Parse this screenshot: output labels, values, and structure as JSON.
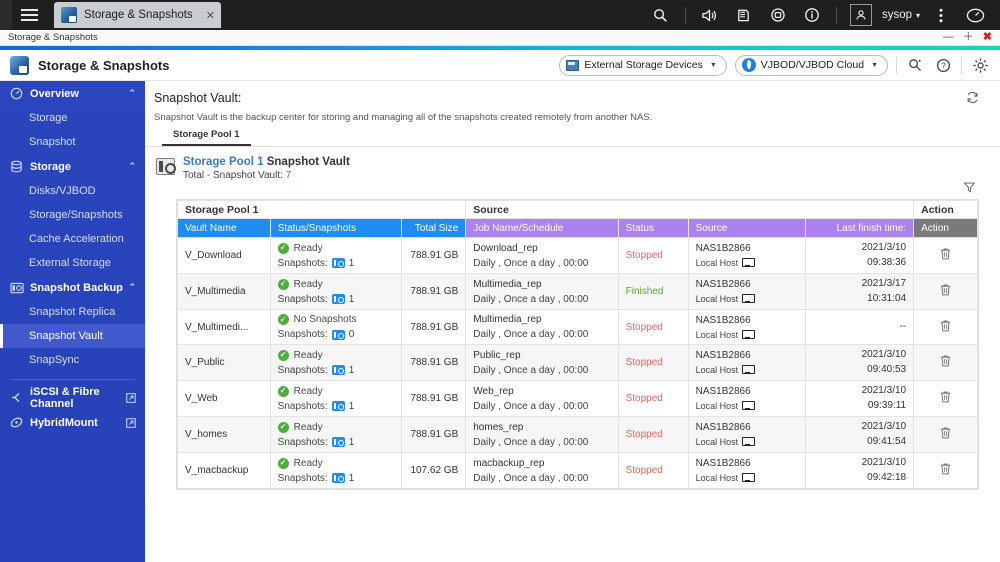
{
  "desktop": {
    "menu_icon": "hamburger-icon",
    "tab": {
      "title": "Storage & Snapshots",
      "close": "✕"
    },
    "icons": [
      "search-icon",
      "volume-icon",
      "backup-icon",
      "external-device-icon",
      "info-icon"
    ],
    "user": {
      "name": "sysop",
      "caret": "▾"
    },
    "more_icon": "kebab-menu-icon",
    "dashboard_icon": "dashboard-icon"
  },
  "window": {
    "title": "Storage & Snapshots",
    "minimize": "—",
    "maximize": "＋",
    "close": "✖"
  },
  "app_header": {
    "title": "Storage & Snapshots",
    "external_storage": {
      "label": "External Storage Devices",
      "caret": "▼"
    },
    "vjbod": {
      "label": "VJBOD/VJBOD Cloud",
      "caret": "▼"
    },
    "icons": [
      "search-settings-icon",
      "help-icon",
      "settings-gear-icon"
    ]
  },
  "sidebar": {
    "groups": [
      {
        "label": "Overview",
        "icon": "speedometer-icon",
        "chevron": "⌃",
        "items": [
          {
            "label": "Storage",
            "active": false
          },
          {
            "label": "Snapshot",
            "active": false
          }
        ]
      },
      {
        "label": "Storage",
        "icon": "database-icon",
        "chevron": "⌃",
        "items": [
          {
            "label": "Disks/VJBOD",
            "active": false
          },
          {
            "label": "Storage/Snapshots",
            "active": false
          },
          {
            "label": "Cache Acceleration",
            "active": false
          },
          {
            "label": "External Storage",
            "active": false
          }
        ]
      },
      {
        "label": "Snapshot Backup",
        "icon": "camera-icon",
        "chevron": "⌃",
        "items": [
          {
            "label": "Snapshot Replica",
            "active": false
          },
          {
            "label": "Snapshot Vault",
            "active": true
          },
          {
            "label": "SnapSync",
            "active": false
          }
        ]
      }
    ],
    "external_links": [
      {
        "label": "iSCSI & Fibre Channel",
        "icon": "iscsi-icon",
        "link_icon": "external-link-icon"
      },
      {
        "label": "HybridMount",
        "icon": "hybridmount-icon",
        "link_icon": "external-link-icon"
      }
    ]
  },
  "content": {
    "title": "Snapshot Vault:",
    "description": "Snapshot Vault is the backup center for storing and managing all of the snapshots created remotely from another NAS.",
    "refresh_icon": "refresh-icon",
    "filter_icon": "filter-icon",
    "tabs": [
      {
        "label": "Storage Pool 1",
        "active": true
      }
    ],
    "pool": {
      "icon": "storage-pool-icon",
      "link": "Storage Pool 1",
      "suffix": " Snapshot Vault",
      "total_label": "Total - Snapshot Vault: ",
      "total_count": "7"
    }
  },
  "table": {
    "group_headers": [
      {
        "label": "Storage Pool 1",
        "kind": "pool"
      },
      {
        "label": "Source",
        "kind": "source"
      },
      {
        "label": "Action",
        "kind": "action"
      }
    ],
    "columns": [
      {
        "label": "Vault Name",
        "kind": "blue-left"
      },
      {
        "label": "Status/Snapshots",
        "kind": "blue-left"
      },
      {
        "label": "Total Size",
        "kind": "blue-right"
      },
      {
        "label": "Job Name/Schedule",
        "kind": "purple-left"
      },
      {
        "label": "Status",
        "kind": "purple-left"
      },
      {
        "label": "Source",
        "kind": "purple-left"
      },
      {
        "label": "Last finish time:",
        "kind": "purple-right"
      },
      {
        "label": "Action",
        "kind": "gray-left"
      }
    ],
    "snapshots_label": "Snapshots:",
    "delete_icon": "trash-icon",
    "rows": [
      {
        "vault_name": "V_Download",
        "status": "Ready",
        "snapshots": "1",
        "total_size": "788.91 GB",
        "job_name": "Download_rep",
        "schedule": "Daily , Once a day , 00:00",
        "job_status": "Stopped",
        "job_status_kind": "stopped",
        "source_name": "NAS1B2866",
        "source_host": "Local Host",
        "finish_date": "2021/3/10",
        "finish_time": "09:38:36"
      },
      {
        "vault_name": "V_Multimedia",
        "status": "Ready",
        "snapshots": "1",
        "total_size": "788.91 GB",
        "job_name": "Multimedia_rep",
        "schedule": "Daily , Once a day , 00:00",
        "job_status": "Finished",
        "job_status_kind": "finished",
        "source_name": "NAS1B2866",
        "source_host": "Local Host",
        "finish_date": "2021/3/17",
        "finish_time": "10:31:04"
      },
      {
        "vault_name": "V_Multimedi...",
        "status": "No Snapshots",
        "snapshots": "0",
        "total_size": "788.91 GB",
        "job_name": "Multimedia_rep",
        "schedule": "Daily , Once a day , 00:00",
        "job_status": "Stopped",
        "job_status_kind": "stopped",
        "source_name": "NAS1B2866",
        "source_host": "Local Host",
        "finish_date": "",
        "finish_time": "--"
      },
      {
        "vault_name": "V_Public",
        "status": "Ready",
        "snapshots": "1",
        "total_size": "788.91 GB",
        "job_name": "Public_rep",
        "schedule": "Daily , Once a day , 00:00",
        "job_status": "Stopped",
        "job_status_kind": "stopped",
        "source_name": "NAS1B2866",
        "source_host": "Local Host",
        "finish_date": "2021/3/10",
        "finish_time": "09:40:53"
      },
      {
        "vault_name": "V_Web",
        "status": "Ready",
        "snapshots": "1",
        "total_size": "788.91 GB",
        "job_name": "Web_rep",
        "schedule": "Daily , Once a day , 00:00",
        "job_status": "Stopped",
        "job_status_kind": "stopped",
        "source_name": "NAS1B2866",
        "source_host": "Local Host",
        "finish_date": "2021/3/10",
        "finish_time": "09:39:11"
      },
      {
        "vault_name": "V_homes",
        "status": "Ready",
        "snapshots": "1",
        "total_size": "788.91 GB",
        "job_name": "homes_rep",
        "schedule": "Daily , Once a day , 00:00",
        "job_status": "Stopped",
        "job_status_kind": "stopped",
        "source_name": "NAS1B2866",
        "source_host": "Local Host",
        "finish_date": "2021/3/10",
        "finish_time": "09:41:54"
      },
      {
        "vault_name": "V_macbackup",
        "status": "Ready",
        "snapshots": "1",
        "total_size": "107.62 GB",
        "job_name": "macbackup_rep",
        "schedule": "Daily , Once a day , 00:00",
        "job_status": "Stopped",
        "job_status_kind": "stopped",
        "source_name": "NAS1B2866",
        "source_host": "Local Host",
        "finish_date": "2021/3/10",
        "finish_time": "09:42:18"
      }
    ]
  },
  "colors": {
    "sidebar": "#2742b8",
    "sidebar_active": "#4159cc",
    "header_blue": "#1e8cf0",
    "header_purple": "#ab82ef",
    "header_gray": "#7a7a7a",
    "status_stopped": "#f2615c",
    "status_finished": "#5aa82e",
    "status_ok": "#4cae3c",
    "link": "#3a78c9"
  }
}
